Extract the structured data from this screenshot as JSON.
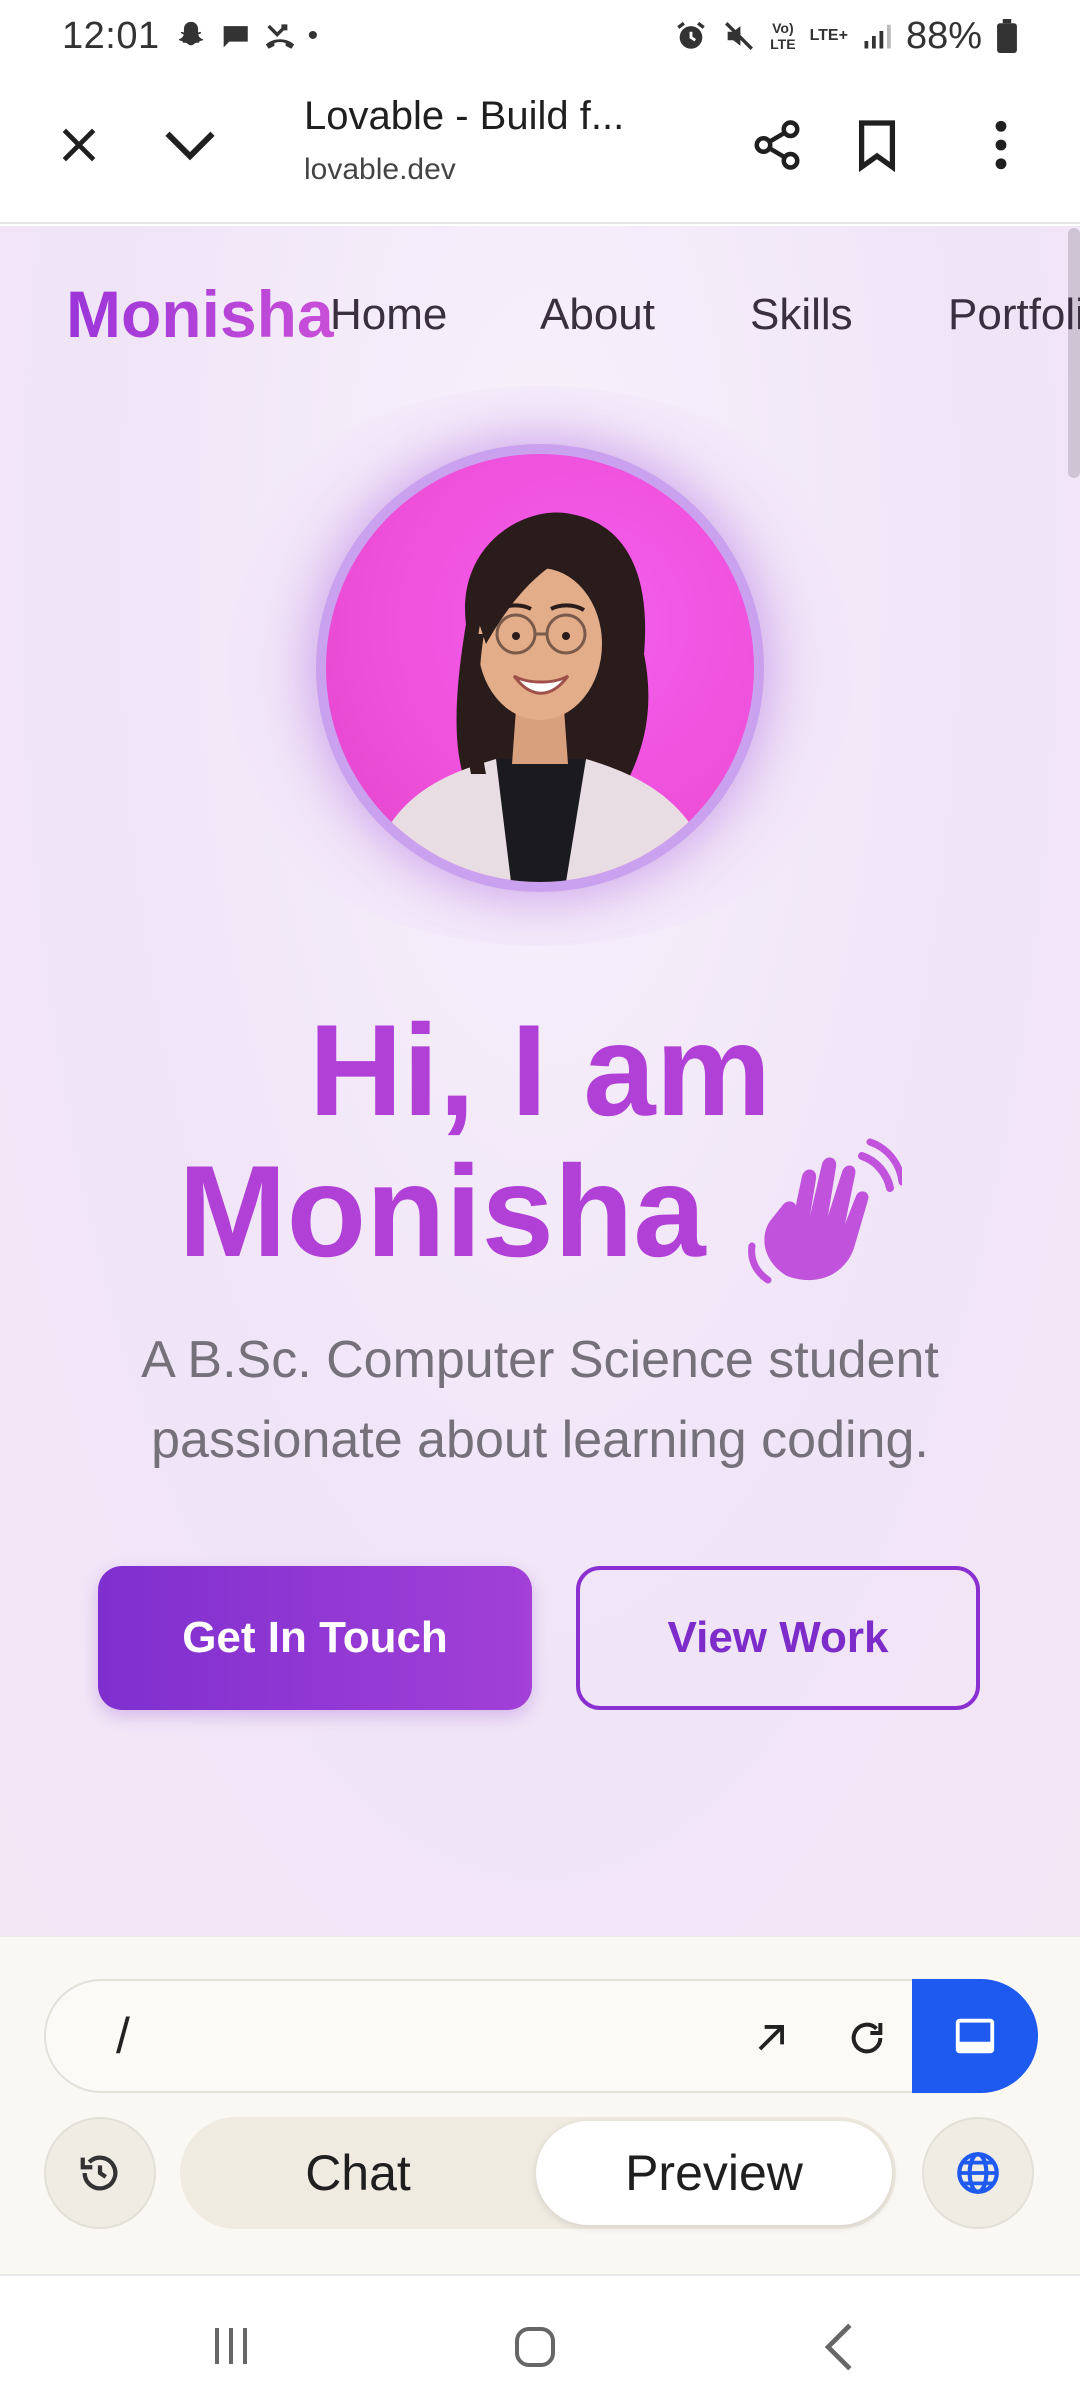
{
  "status_bar": {
    "time": "12:01",
    "dot": "•",
    "volte": "Vo)\nLTE",
    "lte_plus": "LTE+",
    "battery_percent": "88%",
    "icons": [
      "snapchat-icon",
      "chat-bubble-icon",
      "missed-call-icon",
      "alarm-icon",
      "mute-icon",
      "signal-icon",
      "battery-icon"
    ]
  },
  "browser": {
    "title": "Lovable - Build f...",
    "url": "lovable.dev"
  },
  "site": {
    "brand": "Monisha",
    "nav": [
      "Home",
      "About",
      "Skills",
      "Portfolio"
    ],
    "hero_line1": "Hi, I am",
    "hero_line2": "Monisha",
    "subtitle": "A B.Sc. Computer Science student passionate about learning coding.",
    "primary_button": "Get In Touch",
    "secondary_button": "View Work",
    "colors": {
      "accent": "#a83fd6",
      "button_start": "#7f2fcf",
      "button_end": "#a240d8",
      "bg": "#f0e4f7"
    }
  },
  "panel": {
    "path": "/",
    "tabs": [
      "Chat",
      "Preview"
    ],
    "active_tab": "Preview",
    "device_button_color": "#1f5af0"
  }
}
